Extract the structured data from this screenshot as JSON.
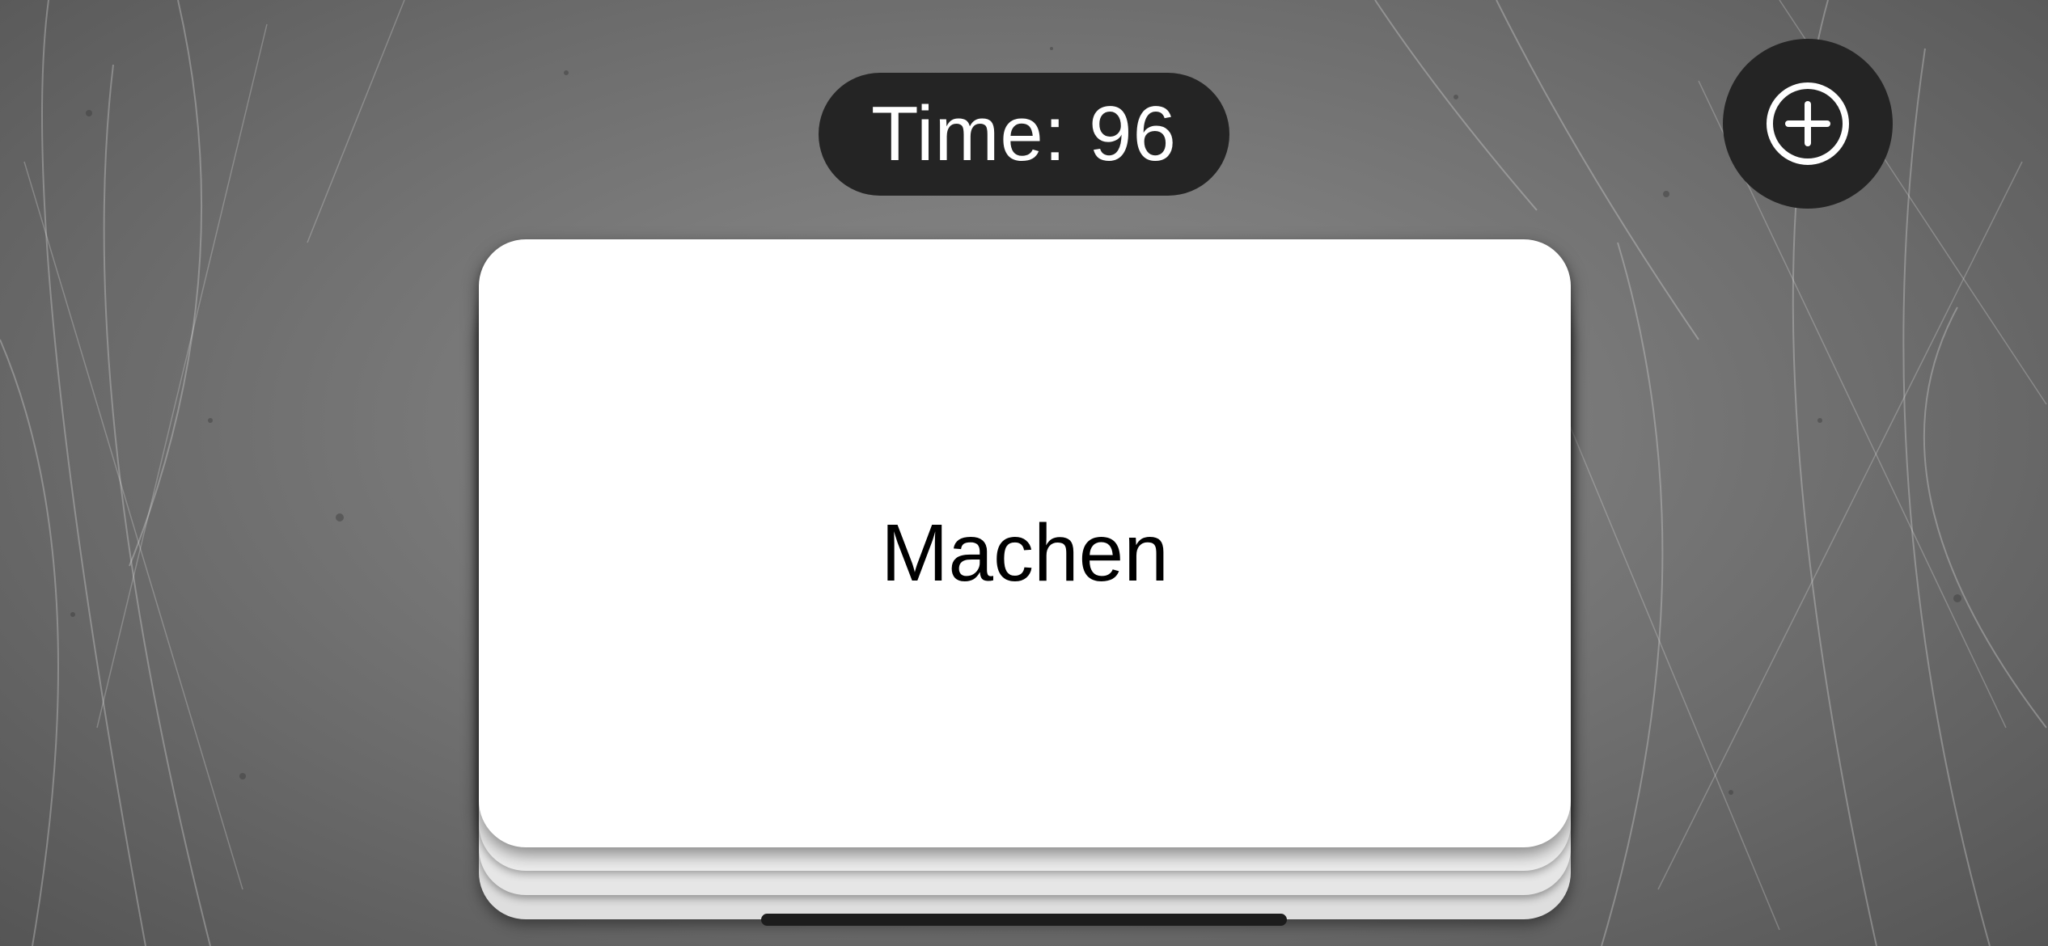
{
  "background": {
    "icon": "scratched-metal-texture"
  },
  "timer": {
    "label": "Time: 96",
    "value": 96
  },
  "add_button": {
    "icon": "plus-circle-icon"
  },
  "card_deck": {
    "front_word": "Machen",
    "stacked_cards_behind": 3
  },
  "colors": {
    "pill_background": "#242424",
    "pill_text": "#ffffff",
    "card_background": "#ffffff",
    "card_text": "#000000"
  }
}
